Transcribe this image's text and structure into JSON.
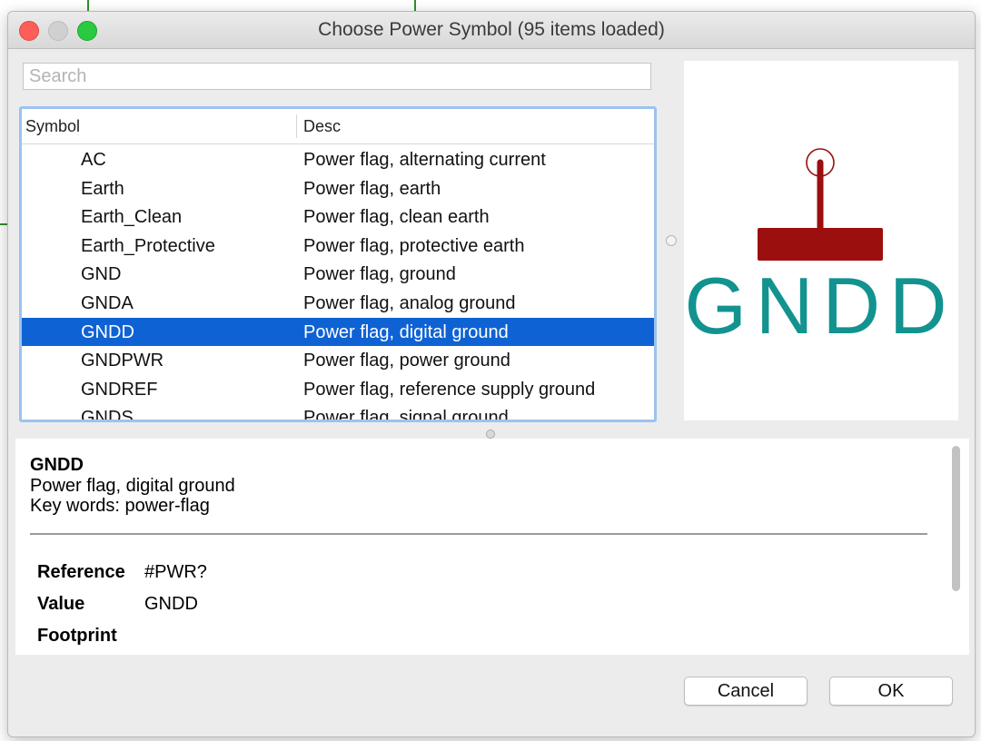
{
  "window": {
    "title": "Choose Power Symbol (95 items loaded)"
  },
  "search": {
    "placeholder": "Search",
    "value": ""
  },
  "list": {
    "columns": [
      "Symbol",
      "Desc"
    ],
    "rows": [
      {
        "symbol": "AC",
        "desc": "Power flag, alternating current"
      },
      {
        "symbol": "Earth",
        "desc": "Power flag, earth"
      },
      {
        "symbol": "Earth_Clean",
        "desc": "Power flag, clean earth"
      },
      {
        "symbol": "Earth_Protective",
        "desc": "Power flag, protective earth"
      },
      {
        "symbol": "GND",
        "desc": "Power flag, ground"
      },
      {
        "symbol": "GNDA",
        "desc": "Power flag, analog ground"
      },
      {
        "symbol": "GNDD",
        "desc": "Power flag, digital ground"
      },
      {
        "symbol": "GNDPWR",
        "desc": "Power flag, power ground"
      },
      {
        "symbol": "GNDREF",
        "desc": "Power flag, reference supply ground"
      },
      {
        "symbol": "GNDS",
        "desc": "Power flag, signal ground"
      }
    ],
    "selected_index": 6
  },
  "preview": {
    "symbol_text": "GNDD",
    "text_color": "#12938f",
    "body_color": "#9b0f0f"
  },
  "details": {
    "name": "GNDD",
    "description": "Power flag, digital ground",
    "keywords": "Key words: power-flag",
    "fields": [
      {
        "key": "Reference",
        "value": "#PWR?"
      },
      {
        "key": "Value",
        "value": "GNDD"
      },
      {
        "key": "Footprint",
        "value": ""
      }
    ]
  },
  "buttons": {
    "cancel": "Cancel",
    "ok": "OK"
  }
}
